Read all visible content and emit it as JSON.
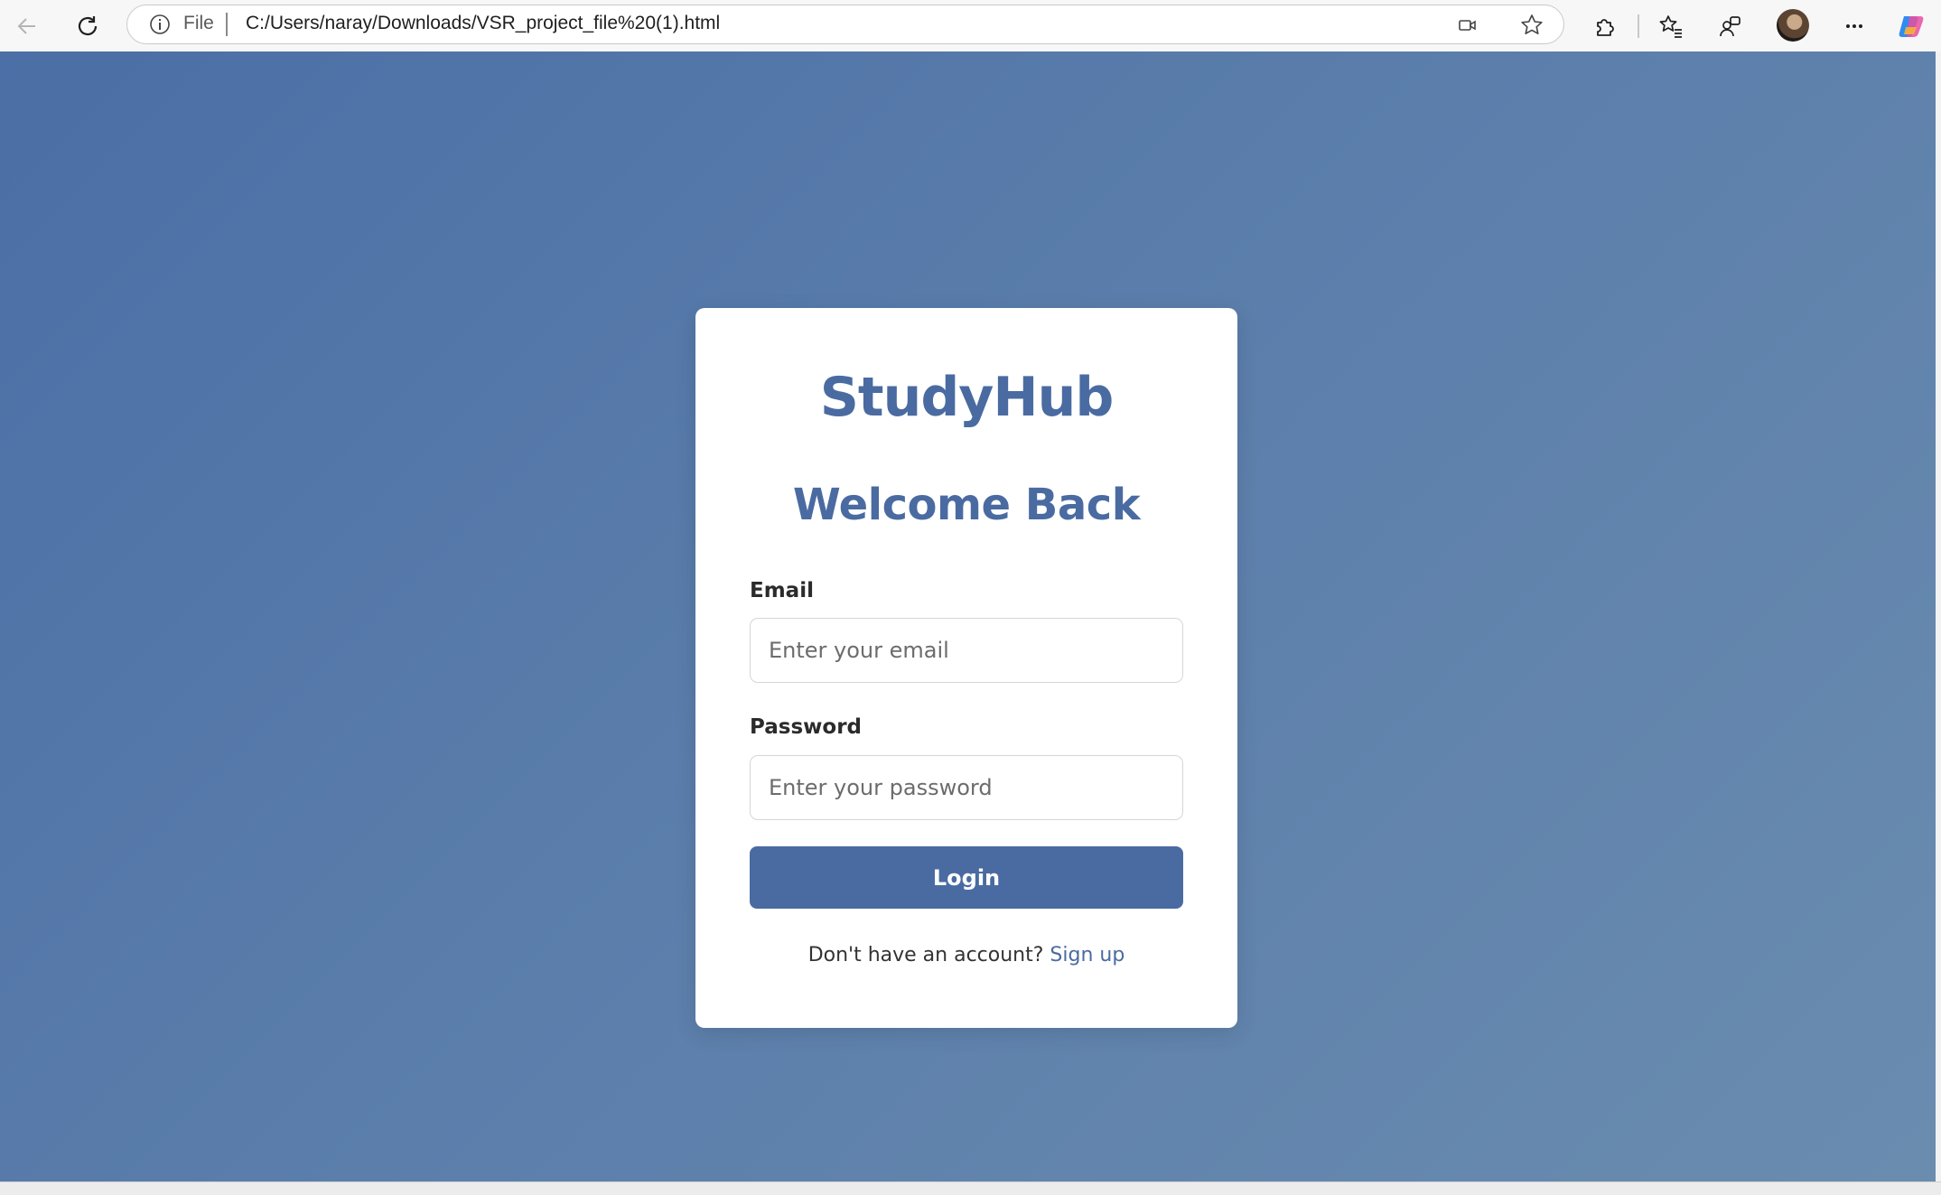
{
  "browser": {
    "address_scheme_label": "File",
    "url": "C:/Users/naray/Downloads/VSR_project_file%20(1).html",
    "icons": {
      "back": "back-arrow-icon",
      "refresh": "refresh-icon",
      "site_info": "info-icon",
      "camera": "video-camera-icon",
      "favorite": "star-icon",
      "extensions": "puzzle-icon",
      "favorites_bar": "favorites-icon",
      "collections": "collections-icon",
      "profile": "avatar",
      "menu": "more-icon",
      "copilot": "copilot-icon"
    }
  },
  "login": {
    "brand": "StudyHub",
    "heading": "Welcome Back",
    "email_label": "Email",
    "email_placeholder": "Enter your email",
    "password_label": "Password",
    "password_placeholder": "Enter your password",
    "login_button": "Login",
    "signup_prompt": "Don't have an account?",
    "signup_link": "Sign up"
  },
  "colors": {
    "accent": "#4a6ba1",
    "background_start": "#4b6fa6",
    "background_end": "#6a8caf",
    "card": "#ffffff"
  }
}
